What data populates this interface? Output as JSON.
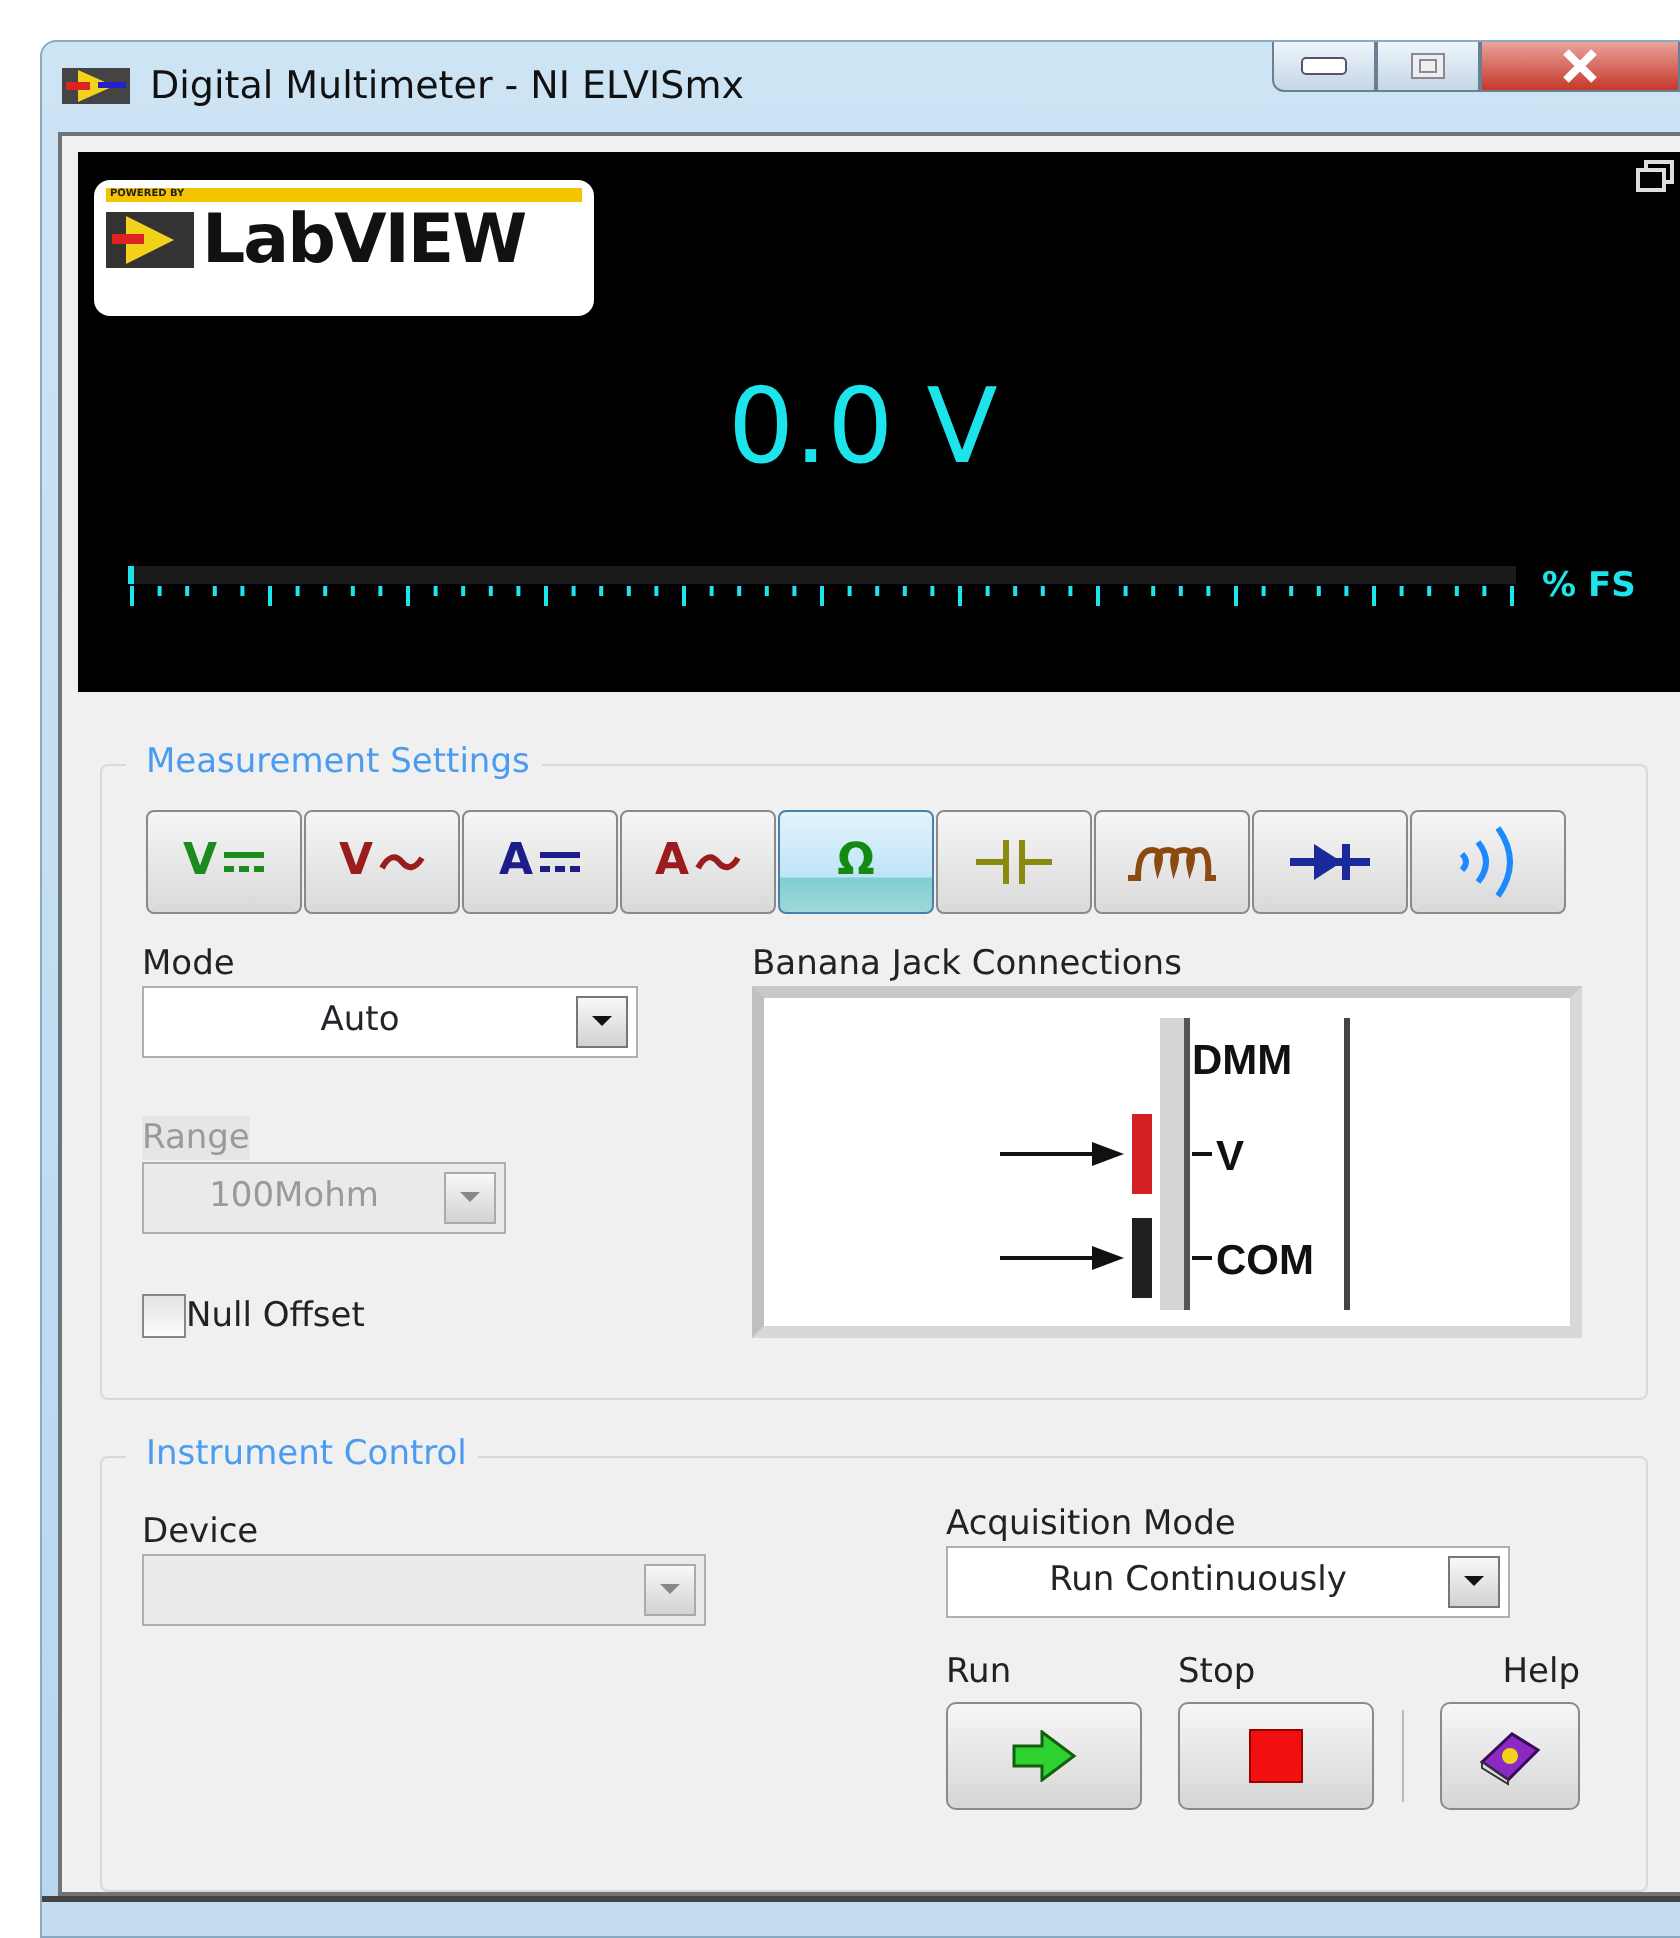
{
  "window": {
    "title": "Digital Multimeter - NI ELVISmx"
  },
  "display": {
    "logo_tagline": "POWERED BY",
    "logo_text": "LabVIEW",
    "reading": "0.0 V",
    "scale": {
      "level": 0,
      "unit": "% FS"
    }
  },
  "measurement_settings": {
    "title": "Measurement Settings",
    "functions": [
      {
        "kind": "dc",
        "label": "V",
        "color": "#1c8a1c",
        "selected": false
      },
      {
        "kind": "ac",
        "label": "V",
        "color": "#9a1c1c",
        "selected": false
      },
      {
        "kind": "dc",
        "label": "A",
        "color": "#1c1c8a",
        "selected": false
      },
      {
        "kind": "ac",
        "label": "A",
        "color": "#9a1c1c",
        "selected": false
      },
      {
        "kind": "text",
        "label": "Ω",
        "color": "#138a13",
        "selected": true
      },
      {
        "kind": "capacitor",
        "color": "#8a8a10",
        "selected": false
      },
      {
        "kind": "inductor",
        "color": "#8a4a10",
        "selected": false
      },
      {
        "kind": "diode",
        "color": "#1a2a9a",
        "selected": false
      },
      {
        "kind": "continuity",
        "color": "#1e88ff",
        "selected": false
      }
    ],
    "mode": {
      "label": "Mode",
      "value": "Auto",
      "disabled": false
    },
    "range": {
      "label": "Range",
      "value": "100Mohm",
      "disabled": true
    },
    "null_offset": {
      "label": "Null Offset",
      "checked": false
    },
    "banana_jacks": {
      "title": "Banana Jack Connections",
      "header": "DMM",
      "jacks": [
        {
          "label": "V",
          "color": "#d42020"
        },
        {
          "label": "COM",
          "color": "#202020"
        }
      ]
    }
  },
  "instrument_control": {
    "title": "Instrument Control",
    "device": {
      "label": "Device",
      "disabled": true
    },
    "acquisition_mode": {
      "label": "Acquisition Mode",
      "value": "Run Continuously",
      "disabled": false
    },
    "buttons": [
      {
        "kind": "run",
        "label": "Run"
      },
      {
        "kind": "stop",
        "label": "Stop"
      },
      {
        "kind": "help",
        "label": "Help"
      }
    ]
  }
}
